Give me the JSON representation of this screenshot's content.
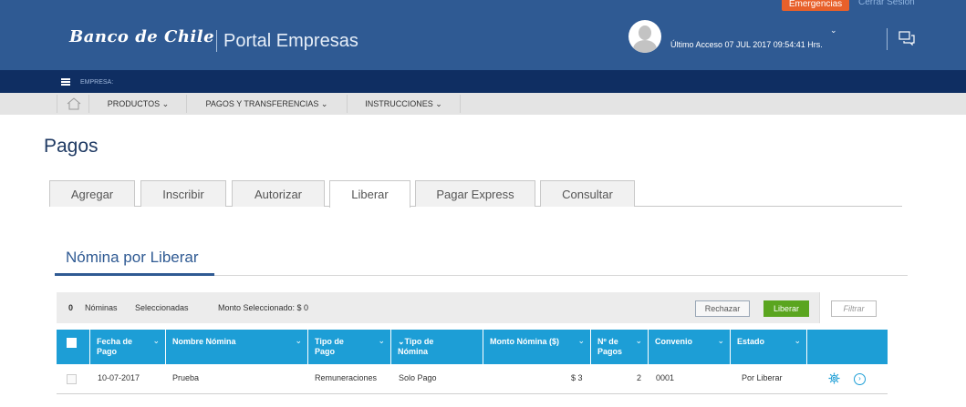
{
  "header": {
    "emergencias": "Emergencias",
    "cerrar_sesion": "Cerrar Sesión",
    "logo": "Banco de Chile",
    "portal": "Portal Empresas",
    "ultimo_acceso": "Último Acceso 07 JUL 2017 09:54:41 Hrs.",
    "chevron": "⌄"
  },
  "empresa_bar": {
    "label": "EMPRESA:"
  },
  "nav": {
    "items": [
      {
        "label": "PRODUCTOS"
      },
      {
        "label": "PAGOS Y TRANSFERENCIAS"
      },
      {
        "label": "INSTRUCCIONES"
      }
    ]
  },
  "page_title": "Pagos",
  "tabs": [
    {
      "label": "Agregar"
    },
    {
      "label": "Inscribir"
    },
    {
      "label": "Autorizar"
    },
    {
      "label": "Liberar",
      "active": true
    },
    {
      "label": "Pagar Express"
    },
    {
      "label": "Consultar"
    }
  ],
  "section_title": "Nómina por Liberar",
  "toolbar": {
    "count": "0",
    "nominas": "Nóminas",
    "seleccionadas": "Seleccionadas",
    "monto": "Monto Seleccionado: $ 0",
    "rechazar": "Rechazar",
    "liberar": "Liberar",
    "filtrar_placeholder": "Filtrar"
  },
  "table": {
    "columns": [
      {
        "line1": "Fecha de",
        "line2": "Pago",
        "chevron": "⌄"
      },
      {
        "line1": "Nombre Nómina",
        "line2": "",
        "chevron": "⌄"
      },
      {
        "line1": "Tipo de",
        "line2": "Pago",
        "chevron": "⌄"
      },
      {
        "line1": "⌄Tipo de",
        "line2": "Nómina",
        "chevron": ""
      },
      {
        "line1": "Monto Nómina ($)",
        "line2": "",
        "chevron": "⌄"
      },
      {
        "line1": "Nº de",
        "line2": "Pagos",
        "chevron": "⌄"
      },
      {
        "line1": "Convenio",
        "line2": "",
        "chevron": "⌄"
      },
      {
        "line1": "Estado",
        "line2": "",
        "chevron": "⌄"
      }
    ],
    "rows": [
      {
        "fecha": "10-07-2017",
        "nombre": "Prueba",
        "tipo_pago": "Remuneraciones",
        "tipo_nomina": "Solo Pago",
        "monto": "$ 3",
        "pagos": "2",
        "convenio": "0001",
        "estado": "Por Liberar"
      }
    ]
  },
  "colors": {
    "header_blue": "#2f5a93",
    "navy": "#0f2e62",
    "table_header": "#1d9ed6",
    "liberar_green": "#5aa51f",
    "emergencias_orange": "#e8602a"
  }
}
